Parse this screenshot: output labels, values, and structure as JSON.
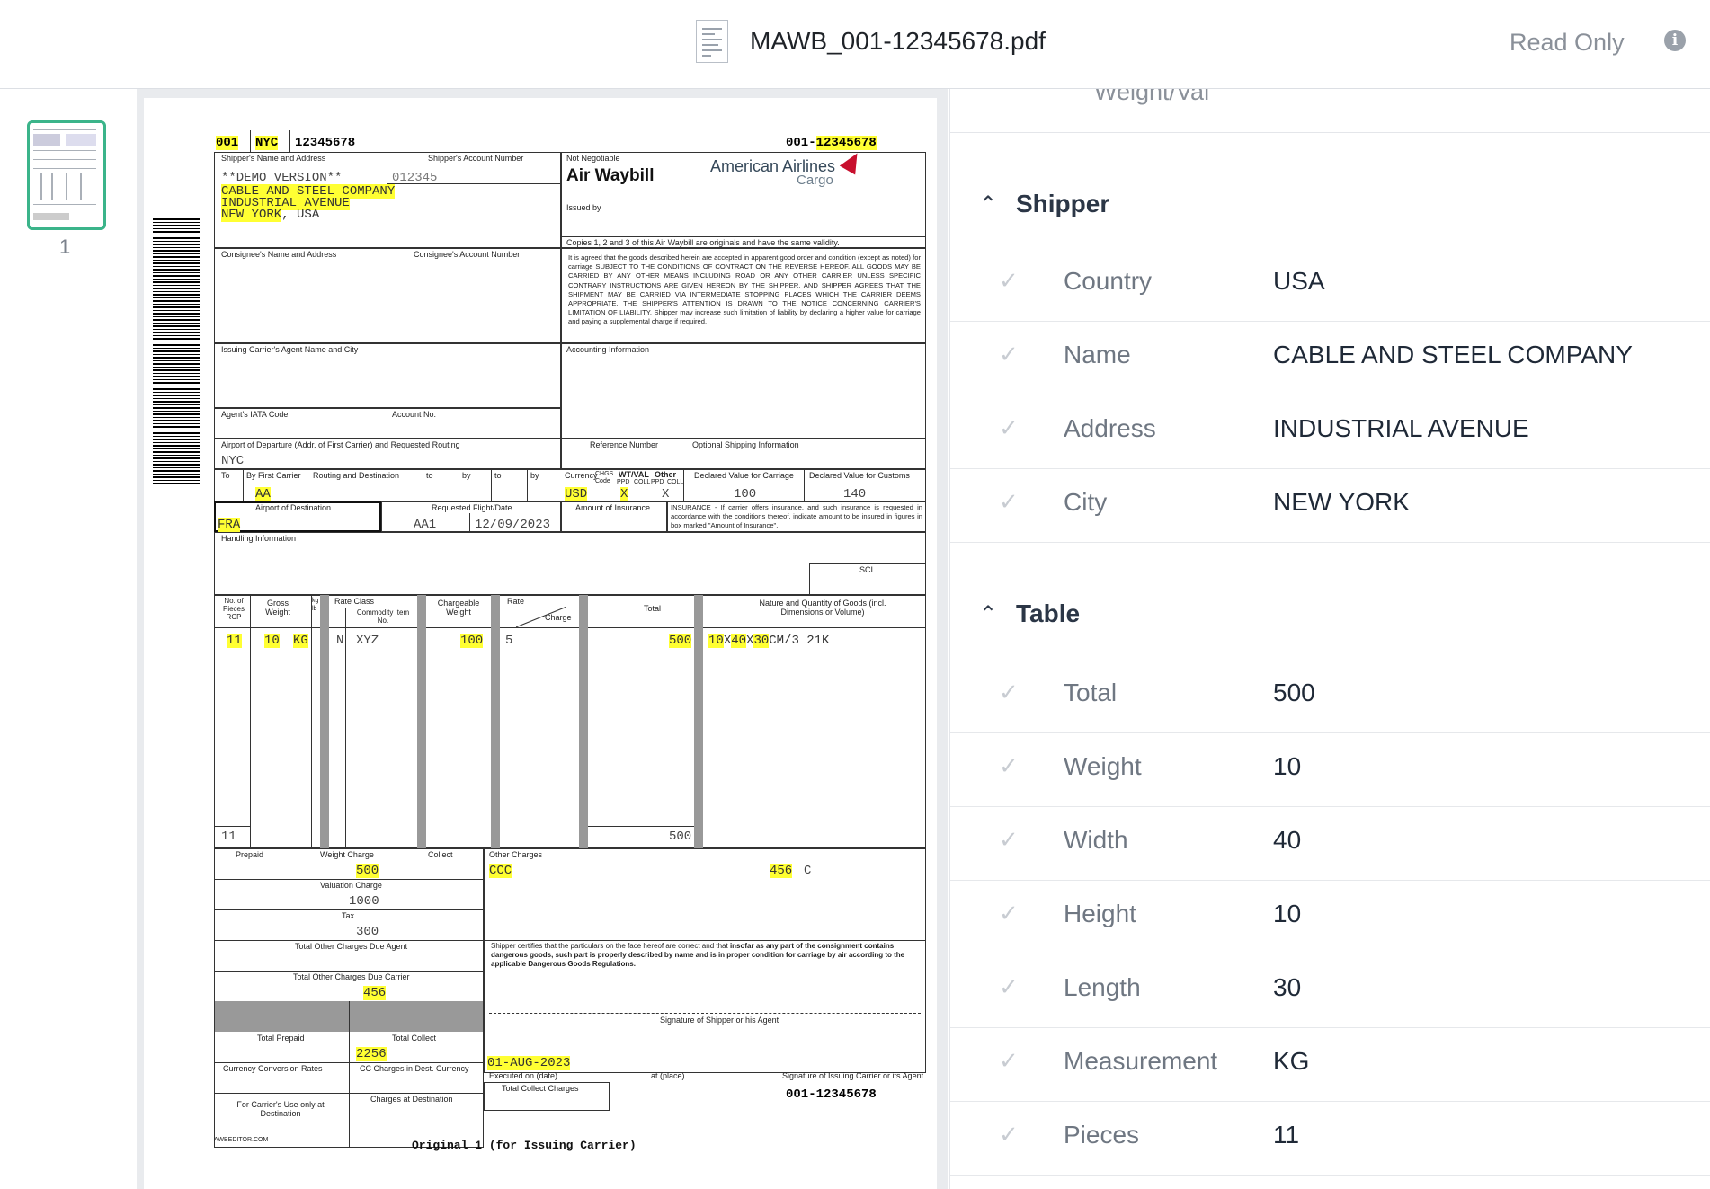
{
  "header": {
    "file_name": "MAWB_001-12345678.pdf",
    "mode": "Read Only"
  },
  "thumbnails": {
    "page_number": "1"
  },
  "awb": {
    "prefix": "001",
    "origin_code": "NYC",
    "serial": "12345678",
    "top_right_prefix": "001-",
    "top_right_serial": "12345678",
    "shipper_label": "Shipper's Name and Address",
    "shipper_account_label": "Shipper's Account Number",
    "shipper_demo": "**DEMO VERSION**",
    "shipper_account": "012345",
    "shipper_line1": "CABLE AND STEEL COMPANY",
    "shipper_line2": "INDUSTRIAL AVENUE",
    "shipper_line3a": "NEW YORK",
    "shipper_line3b": ", USA",
    "not_negotiable": "Not Negotiable",
    "title": "Air Waybill",
    "issued_by": "Issued by",
    "airline_logo": "American Airlines",
    "airline_logo_sub": "Cargo",
    "copies_note": "Copies 1, 2 and 3 of this Air Waybill are originals and have the same validity.",
    "consignee_label": "Consignee's Name and Address",
    "consignee_account_label": "Consignee's Account Number",
    "terms": "It is agreed that the goods described herein are accepted in apparent good order and condition (except as noted) for carriage SUBJECT TO THE CONDITIONS OF CONTRACT ON THE REVERSE HEREOF. ALL GOODS MAY BE CARRIED BY ANY OTHER MEANS INCLUDING ROAD OR ANY OTHER CARRIER UNLESS SPECIFIC CONTRARY INSTRUCTIONS ARE GIVEN HEREON BY THE SHIPPER, AND SHIPPER AGREES THAT THE SHIPMENT MAY BE CARRIED VIA INTERMEDIATE STOPPING PLACES WHICH THE CARRIER DEEMS APPROPRIATE. THE SHIPPER'S ATTENTION IS DRAWN TO THE NOTICE CONCERNING CARRIER'S LIMITATION OF LIABILITY. Shipper may increase such limitation of liability by declaring a higher value for carriage and paying a supplemental charge if required.",
    "agent_label": "Issuing Carrier's Agent Name and City",
    "accounting_label": "Accounting Information",
    "iata_label": "Agent's IATA Code",
    "account_no_label": "Account No.",
    "departure_label": "Airport of Departure (Addr. of First Carrier) and Requested Routing",
    "reference_label": "Reference Number",
    "optional_label": "Optional Shipping Information",
    "departure": "NYC",
    "to_label": "To",
    "first_carrier_label": "By First Carrier",
    "routing_label": "Routing and Destination",
    "to2": "to",
    "by2": "by",
    "to3": "to",
    "by3": "by",
    "currency_label": "Currency",
    "chgs_label": "CHGS Code",
    "wtval_label": "WT/VAL",
    "other_label": "Other",
    "ppd": "PPD",
    "coll": "COLL",
    "declared_carriage_label": "Declared Value for Carriage",
    "declared_customs_label": "Declared Value for Customs",
    "carrier": "AA",
    "currency": "USD",
    "wt_ppd": "X",
    "other_coll": "X",
    "declared_carriage": "100",
    "declared_customs": "140",
    "destination_label": "Airport of Destination",
    "flight_label": "Requested Flight/Date",
    "insurance_label": "Amount of Insurance",
    "insurance_note": "INSURANCE - If carrier offers insurance, and such insurance is requested in accordance with the conditions thereof, indicate amount to be insured in figures in box marked \"Amount of Insurance\".",
    "destination": "FRA",
    "flight": "AA1",
    "flight_date": "12/09/2023",
    "handling_label": "Handling Information",
    "sci": "SCI",
    "pieces_label": "No. of Pieces RCP",
    "gross_label": "Gross Weight",
    "kg_lb": "kg lb",
    "rate_class_label": "Rate Class",
    "commodity_label": "Commodity Item No.",
    "chargeable_label": "Chargeable Weight",
    "rate_label": "Rate",
    "charge_label": "Charge",
    "total_label": "Total",
    "nature_label": "Nature and Quantity of Goods (incl. Dimensions or Volume)",
    "pieces": "11",
    "gross": "10",
    "unit": "KG",
    "rate_class": "N",
    "commodity": "XYZ",
    "chargeable": "100",
    "rate": "5",
    "total": "500",
    "dims_l": "10",
    "dims_x1": "X",
    "dims_w": "40",
    "dims_x2": "X",
    "dims_h": "30",
    "dims_rest": "CM/3 21K",
    "pieces_sum": "11",
    "total_sum": "500",
    "prepaid_label": "Prepaid",
    "weight_charge_label": "Weight Charge",
    "collect_label": "Collect",
    "other_charges_label": "Other Charges",
    "weight_charge": "500",
    "other_code": "CCC",
    "other_amount": "456",
    "other_flag": "C",
    "valuation_label": "Valuation Charge",
    "valuation": "1000",
    "tax_label": "Tax",
    "tax": "300",
    "due_agent_label": "Total Other Charges Due Agent",
    "due_carrier_label": "Total Other Charges Due Carrier",
    "due_carrier": "456",
    "certify_a": "Shipper certifies that the particulars on the face hereof are correct and that ",
    "certify_b": "insofar as any part of the consignment contains dangerous goods, such part is properly described by name and is in proper condition for carriage by air according to the applicable Dangerous Goods Regulations.",
    "signature_shipper_label": "Signature of Shipper or his Agent",
    "total_prepaid_label": "Total Prepaid",
    "total_collect_label": "Total Collect",
    "total_prepaid": "2256",
    "conversion_label": "Currency Conversion Rates",
    "cc_charges_label": "CC Charges in Dest. Currency",
    "executed_date": "01-AUG-2023",
    "executed_on_label": "Executed on (date)",
    "at_place_label": "at (place)",
    "signature_carrier_label": "Signature of Issuing Carrier or its Agent",
    "carrier_use_label": "For Carrier's Use only at Destination",
    "charges_dest_label": "Charges at Destination",
    "total_collect_charges_label": "Total Collect Charges",
    "bottom_awb": "001-12345678",
    "footer_site": "AWBEDITOR.COM",
    "footer_original": "Original 1 (for Issuing Carrier)"
  },
  "panel": {
    "cut_label": "Weight/Val",
    "sections": [
      {
        "title": "Shipper",
        "fields": [
          {
            "key": "Country",
            "value": "USA"
          },
          {
            "key": "Name",
            "value": "CABLE AND STEEL COMPANY"
          },
          {
            "key": "Address",
            "value": "INDUSTRIAL AVENUE"
          },
          {
            "key": "City",
            "value": "NEW YORK"
          }
        ]
      },
      {
        "title": "Table",
        "fields": [
          {
            "key": "Total",
            "value": "500"
          },
          {
            "key": "Weight",
            "value": "10"
          },
          {
            "key": "Width",
            "value": "40"
          },
          {
            "key": "Height",
            "value": "10"
          },
          {
            "key": "Length",
            "value": "30"
          },
          {
            "key": "Measurement",
            "value": "KG"
          },
          {
            "key": "Pieces",
            "value": "11"
          }
        ]
      }
    ]
  },
  "colors": {
    "highlight": "#ffff33",
    "thumb_border": "#3bb48a",
    "panel_text": "#1f2937"
  },
  "icons": {
    "info": "info-icon",
    "collapse": "chevron-up-icon",
    "check": "check-icon",
    "file": "pdf-file-icon"
  }
}
